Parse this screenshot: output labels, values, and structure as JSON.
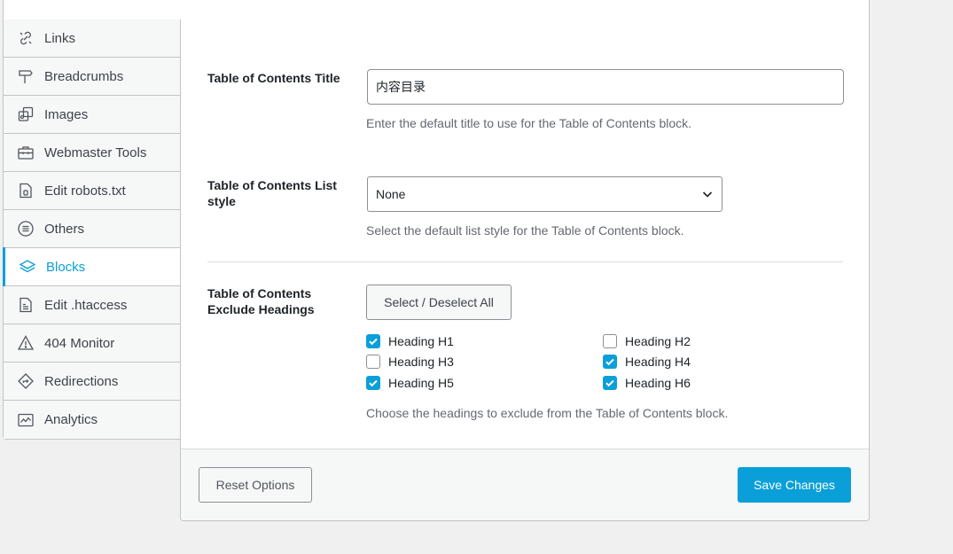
{
  "sidebar": {
    "items": [
      {
        "label": "Links",
        "icon": "link-icon"
      },
      {
        "label": "Breadcrumbs",
        "icon": "signpost-icon"
      },
      {
        "label": "Images",
        "icon": "images-icon"
      },
      {
        "label": "Webmaster Tools",
        "icon": "toolbox-icon"
      },
      {
        "label": "Edit robots.txt",
        "icon": "file-icon"
      },
      {
        "label": "Others",
        "icon": "list-circle-icon"
      },
      {
        "label": "Blocks",
        "icon": "blocks-icon",
        "active": true
      },
      {
        "label": "Edit .htaccess",
        "icon": "file-text-icon"
      },
      {
        "label": "404 Monitor",
        "icon": "warning-icon"
      },
      {
        "label": "Redirections",
        "icon": "redirect-icon"
      },
      {
        "label": "Analytics",
        "icon": "chart-icon"
      }
    ]
  },
  "toc_title": {
    "label": "Table of Contents Title",
    "value": "内容目录",
    "description": "Enter the default title to use for the Table of Contents block."
  },
  "toc_list_style": {
    "label": "Table of Contents List style",
    "selected": "None",
    "description": "Select the default list style for the Table of Contents block."
  },
  "toc_exclude": {
    "label": "Table of Contents Exclude Headings",
    "select_all_label": "Select / Deselect All",
    "headings": [
      {
        "label": "Heading H1",
        "checked": true
      },
      {
        "label": "Heading H2",
        "checked": false
      },
      {
        "label": "Heading H3",
        "checked": false
      },
      {
        "label": "Heading H4",
        "checked": true
      },
      {
        "label": "Heading H5",
        "checked": true
      },
      {
        "label": "Heading H6",
        "checked": true
      }
    ],
    "description": "Choose the headings to exclude from the Table of Contents block."
  },
  "footer": {
    "reset_label": "Reset Options",
    "save_label": "Save Changes"
  },
  "colors": {
    "accent": "#0a9fd8",
    "border": "#c3c4c7",
    "muted_text": "#646970"
  }
}
